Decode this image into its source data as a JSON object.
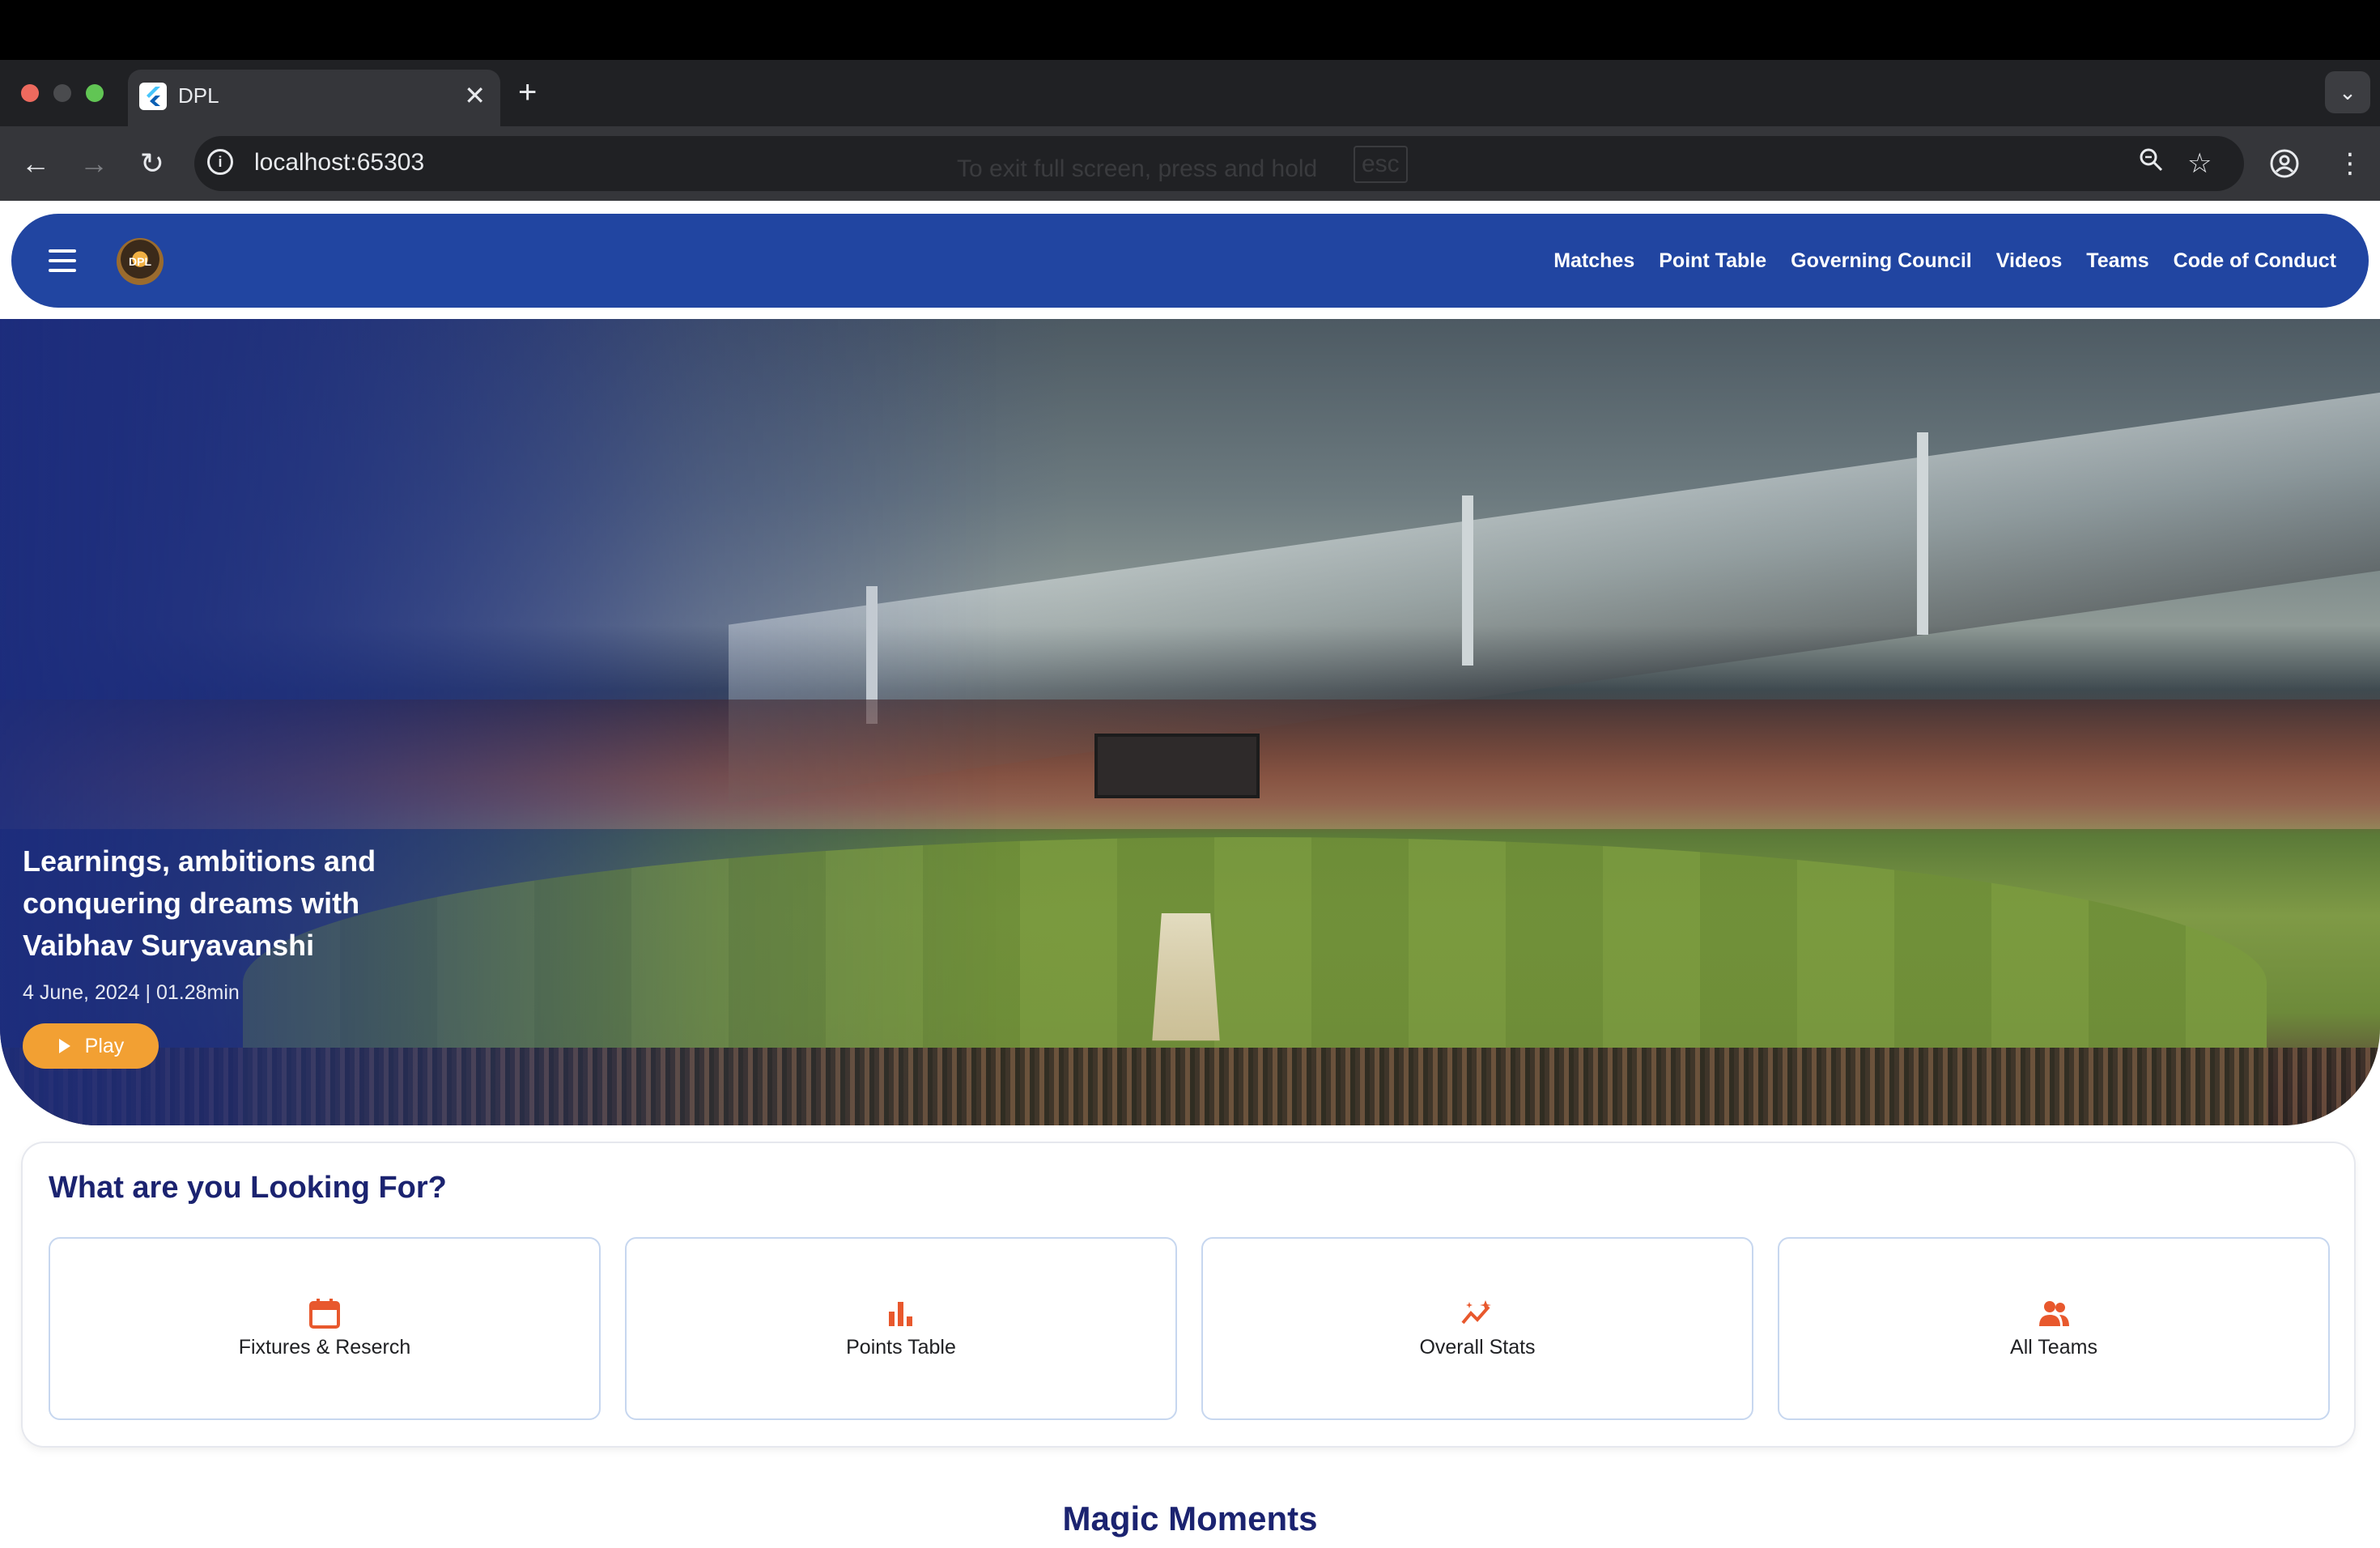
{
  "browser": {
    "tab_title": "DPL",
    "url": "localhost:65303",
    "fullscreen_hint": "To exit full screen, press and hold",
    "fullscreen_key": "esc"
  },
  "header": {
    "nav": [
      "Matches",
      "Point Table",
      "Governing Council",
      "Videos",
      "Teams",
      "Code of Conduct"
    ]
  },
  "hero": {
    "title": "Learnings, ambitions and conquering dreams with Vaibhav Suryavanshi",
    "meta": "4 June, 2024 | 01.28min",
    "play_label": "Play"
  },
  "looking_for": {
    "title": "What are you Looking For?",
    "tiles": [
      {
        "label": "Fixtures & Reserch",
        "icon": "calendar-icon"
      },
      {
        "label": "Points Table",
        "icon": "bar-chart-icon"
      },
      {
        "label": "Overall Stats",
        "icon": "trending-stats-icon"
      },
      {
        "label": "All Teams",
        "icon": "group-icon"
      }
    ]
  },
  "magic_moments": {
    "title": "Magic Moments"
  },
  "colors": {
    "brand_blue": "#2145a1",
    "heading_navy": "#1b2370",
    "play_orange": "#f2a033",
    "icon_orange": "#e8582d"
  }
}
